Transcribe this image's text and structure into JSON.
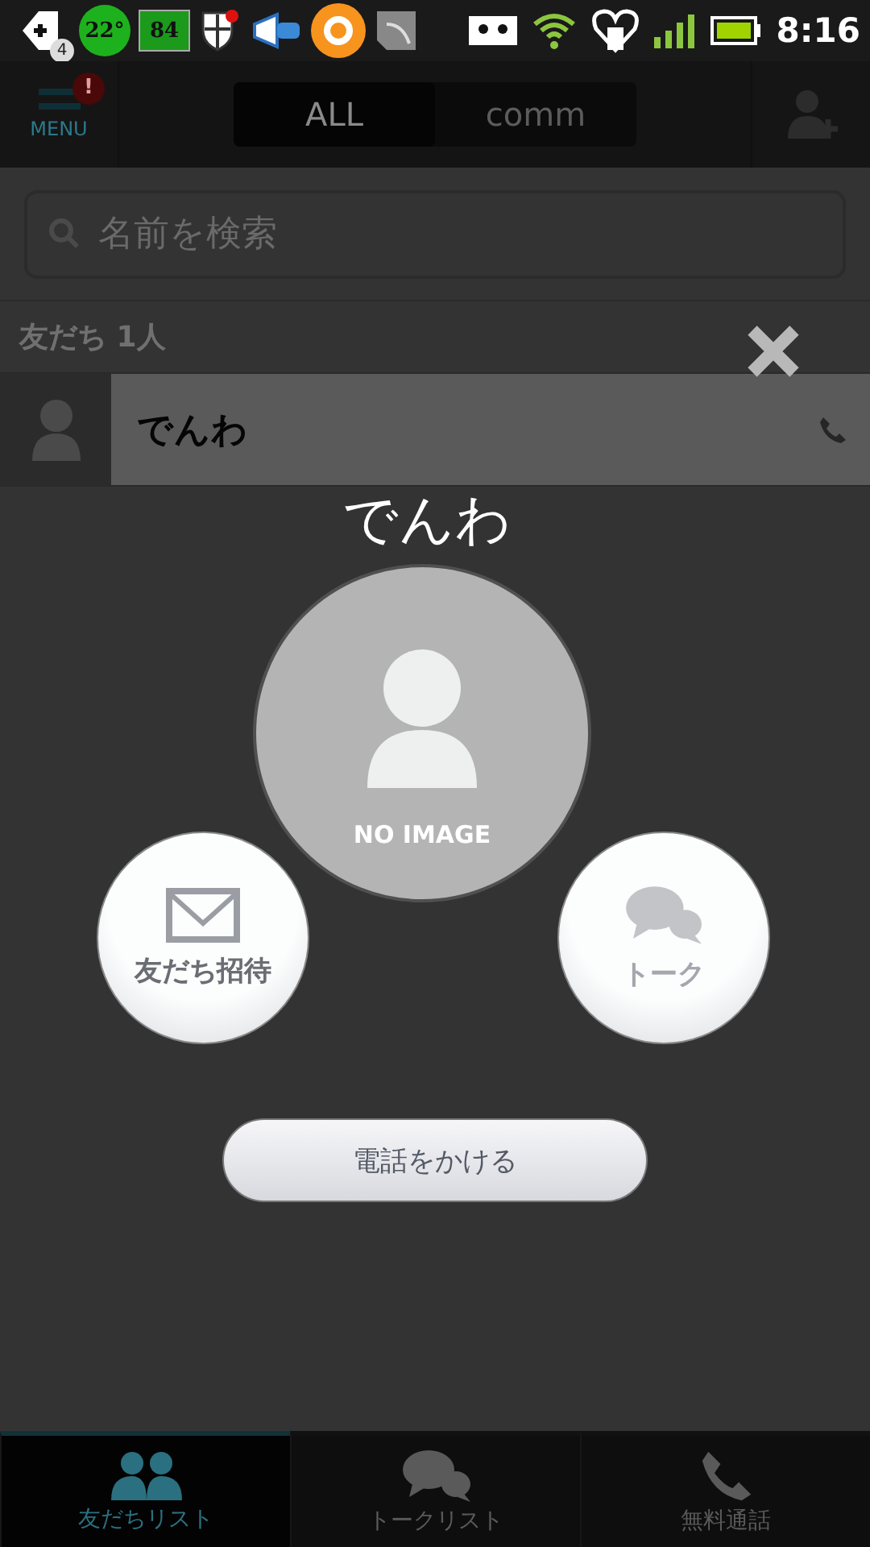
{
  "status_bar": {
    "notification_count": "4",
    "temperature": "22°",
    "battery_widget": "84",
    "time": "8:16"
  },
  "header": {
    "menu_label": "MENU",
    "menu_badge": "!",
    "tabs": [
      {
        "label": "ALL",
        "selected": true
      },
      {
        "label": "comm",
        "selected": false
      }
    ]
  },
  "search": {
    "placeholder": "名前を検索"
  },
  "section_header": "友だち 1人",
  "friends": [
    {
      "name": "でんわ"
    }
  ],
  "dialog": {
    "name": "でんわ",
    "avatar_caption": "NO IMAGE",
    "actions": [
      {
        "label": "友だち招待",
        "kind": "invite",
        "disabled": false
      },
      {
        "label": "トーク",
        "kind": "talk",
        "disabled": true
      }
    ],
    "call_button": "電話をかける"
  },
  "bottom_tabs": [
    {
      "label": "友だちリスト",
      "kind": "friends",
      "selected": true
    },
    {
      "label": "トークリスト",
      "kind": "talk",
      "selected": false
    },
    {
      "label": "無料通話",
      "kind": "call",
      "selected": false
    }
  ]
}
